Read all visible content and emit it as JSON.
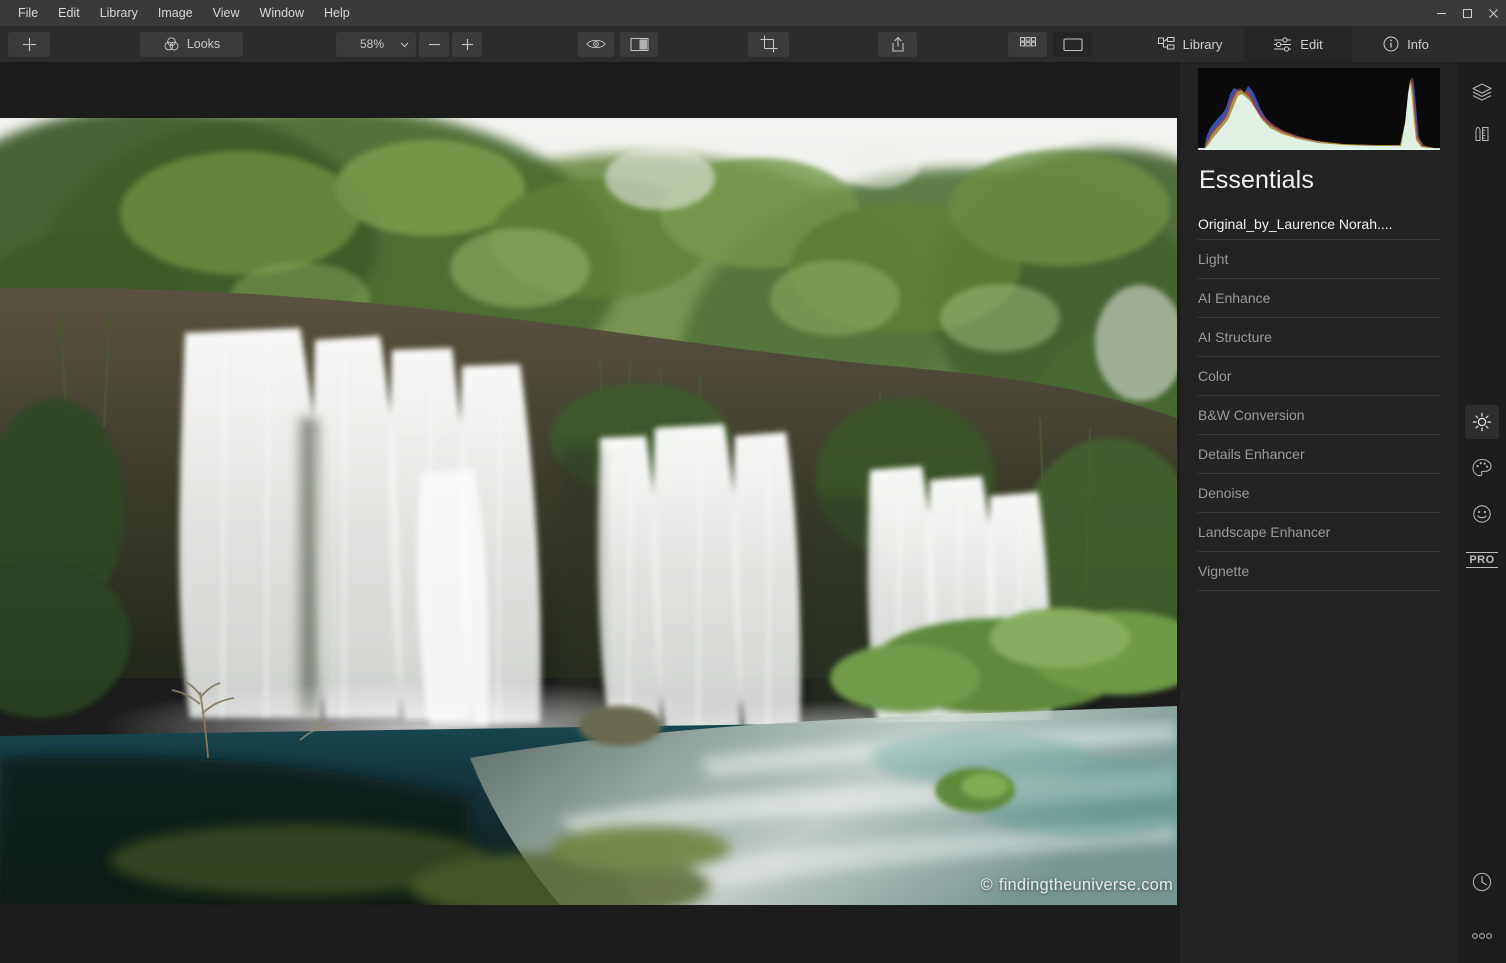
{
  "window": {
    "controls": [
      {
        "name": "minimize",
        "glyph": "minimize-icon"
      },
      {
        "name": "maximize",
        "glyph": "maximize-icon"
      },
      {
        "name": "close",
        "glyph": "close-icon"
      }
    ]
  },
  "menubar": {
    "items": [
      "File",
      "Edit",
      "Library",
      "Image",
      "View",
      "Window",
      "Help"
    ]
  },
  "toolbar": {
    "add_label": "",
    "add_icon": "plus-icon",
    "looks_label": "Looks",
    "looks_icon": "looks-venn-icon",
    "zoom_value": "58%",
    "zoom_dropdown_icon": "chevron-down-icon",
    "zoom_out_label": "−",
    "zoom_in_label": "+",
    "eye_icon": "eye-icon",
    "compare_icon": "before-after-icon",
    "crop_icon": "crop-icon",
    "share_icon": "share-export-icon",
    "grid_icon": "grid-view-icon",
    "single_icon": "single-view-icon"
  },
  "panel_tabs": [
    {
      "label": "Library",
      "icon": "library-icon",
      "active": false
    },
    {
      "label": "Edit",
      "icon": "sliders-icon",
      "active": true
    },
    {
      "label": "Info",
      "icon": "info-icon",
      "active": false
    }
  ],
  "right_panel": {
    "title": "Essentials",
    "preset_name": "Original_by_Laurence Norah....",
    "filters": [
      "Light",
      "AI Enhance",
      "AI Structure",
      "Color",
      "B&W Conversion",
      "Details Enhancer",
      "Denoise",
      "Landscape Enhancer",
      "Vignette"
    ]
  },
  "icon_rail": {
    "top": [
      {
        "name": "layers-icon",
        "active": false
      },
      {
        "name": "tools-ruler-icon",
        "active": false
      }
    ],
    "middle": [
      {
        "name": "sun-brightness-icon",
        "active": true
      },
      {
        "name": "palette-color-icon",
        "active": false
      },
      {
        "name": "portrait-face-icon",
        "active": false
      },
      {
        "name": "pro-badge",
        "label": "PRO",
        "active": false
      }
    ],
    "bottom": [
      {
        "name": "history-clock-icon",
        "active": false
      },
      {
        "name": "more-options-icon",
        "active": false
      }
    ]
  },
  "canvas": {
    "watermark_symbol": "©",
    "watermark_text": "findingtheuniverse.com",
    "image_alt": "Long-exposure photograph of a wide multi-tier waterfall surrounded by dense green trees, flowing into a turquoise pool and rapids"
  },
  "colors": {
    "menubar_bg": "#3a3a3a",
    "toolbar_bg": "#2c2c2c",
    "panel_bg": "#232323",
    "rail_bg": "#1d1d1d",
    "canvas_bg": "#1c1c1c",
    "text_primary": "#f0f0f0",
    "text_secondary": "#9a9a9a",
    "divider": "#3a3a3a",
    "active_tab_bg": "#262626"
  }
}
